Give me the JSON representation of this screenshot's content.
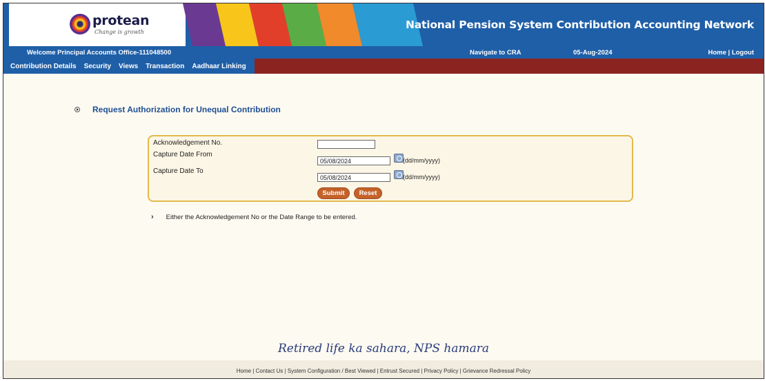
{
  "header": {
    "logo_name": "protean",
    "logo_tagline": "Change is growth",
    "title": "National Pension System Contribution Accounting Network"
  },
  "infobar": {
    "welcome": "Welcome Principal Accounts Office-111048500",
    "navigate": "Navigate to CRA",
    "date": "05-Aug-2024",
    "links": "Home | Logout"
  },
  "menu": {
    "items": [
      "Contribution Details",
      "Security",
      "Views",
      "Transaction",
      "Aadhaar Linking"
    ]
  },
  "page": {
    "heading": "Request Authorization for Unequal Contribution"
  },
  "form": {
    "ack_label": "Acknowledgement No.",
    "ack_value": "",
    "from_label": "Capture Date From",
    "from_value": "05/08/2024",
    "to_label": "Capture Date To",
    "to_value": "05/08/2024",
    "date_format": "(dd/mm/yyyy)",
    "submit_label": "Submit",
    "reset_label": "Reset"
  },
  "note": "Either the Acknowledgement No or the Date Range to be entered.",
  "tagline": "Retired life ka sahara, NPS hamara",
  "footer": "Home | Contact Us | System Configuration / Best Viewed | Entrust Secured | Privacy Policy | Grievance Redressal Policy",
  "colors": {
    "brand_blue": "#1f5fa8",
    "menu_red": "#8b2420",
    "panel_border": "#e2b94a",
    "button": "#c4622a",
    "heading_blue": "#1f4f93",
    "stripe_colors": [
      "#6a3a93",
      "#f8c51a",
      "#e23f2a",
      "#5aad46",
      "#f08a2a",
      "#2a9bd3"
    ]
  }
}
